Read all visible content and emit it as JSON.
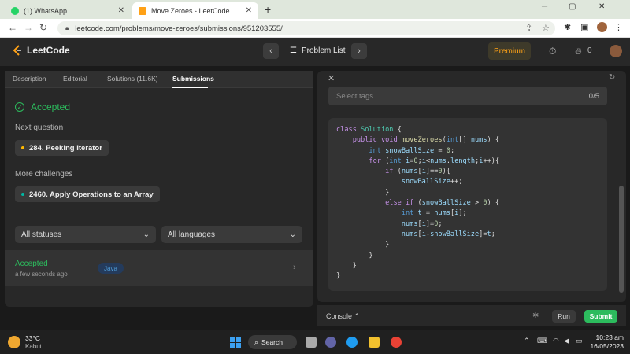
{
  "browser": {
    "tabs": [
      {
        "title": "(1) WhatsApp",
        "favicon": "whatsapp-icon",
        "active": false
      },
      {
        "title": "Move Zeroes - LeetCode",
        "favicon": "leetcode-icon",
        "active": true
      }
    ],
    "url": "leetcode.com/problems/move-zeroes/submissions/951203555/"
  },
  "nav": {
    "logo_text": "LeetCode",
    "problem_list_label": "Problem List",
    "premium_label": "Premium",
    "streak_count": "0"
  },
  "left": {
    "tabs": [
      "Description",
      "Editorial",
      "Solutions (11.6K)",
      "Submissions"
    ],
    "accepted_label": "Accepted",
    "next_question_label": "Next question",
    "next_question": "284. Peeking Iterator",
    "more_challenges_label": "More challenges",
    "challenge": "2460. Apply Operations to an Array",
    "status_filter": "All statuses",
    "language_filter": "All languages",
    "submission": {
      "status": "Accepted",
      "time": "a few seconds ago",
      "language": "Java"
    }
  },
  "right": {
    "tags_placeholder": "Select tags",
    "tags_count": "0/5",
    "code": [
      "class Solution {",
      "    public void moveZeroes(int[] nums) {",
      "        int snowBallSize = 0;",
      "        for (int i=0;i<nums.length;i++){",
      "            if (nums[i]==0){",
      "                snowBallSize++;",
      "            }",
      "            else if (snowBallSize > 0) {",
      "                int t = nums[i];",
      "                nums[i]=0;",
      "                nums[i-snowBallSize]=t;",
      "            }",
      "        }",
      "    }",
      "}"
    ],
    "console_label": "Console",
    "run_label": "Run",
    "submit_label": "Submit"
  },
  "taskbar": {
    "temperature": "33°C",
    "weather": "Kabut",
    "search_label": "Search",
    "time": "10:23 am",
    "date": "16/05/2023"
  },
  "colors": {
    "accent_green": "#2cbb5d",
    "premium_orange": "#ffa116",
    "bg_dark": "#1a1a1a"
  }
}
